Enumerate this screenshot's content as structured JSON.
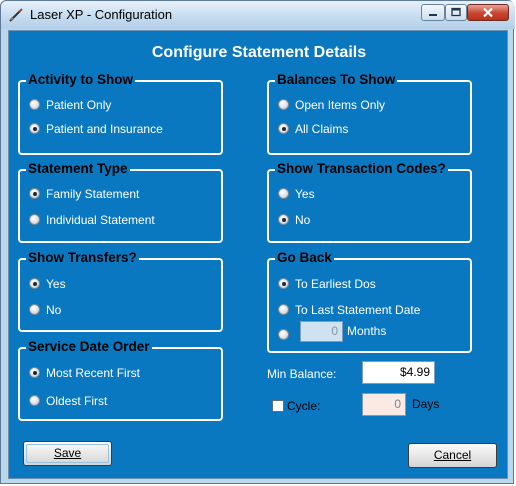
{
  "window": {
    "title": "Laser XP - Configuration",
    "controls": [
      "minimize-icon",
      "maximize-icon",
      "close-icon"
    ]
  },
  "heading": "Configure Statement Details",
  "groups": {
    "activity": {
      "title": "Activity to Show",
      "options": [
        {
          "label": "Patient Only",
          "checked": false
        },
        {
          "label": "Patient and Insurance",
          "checked": true
        }
      ]
    },
    "statement_type": {
      "title": "Statement Type",
      "options": [
        {
          "label": "Family Statement",
          "checked": true
        },
        {
          "label": "Individual Statement",
          "checked": false
        }
      ]
    },
    "transfers": {
      "title": "Show Transfers?",
      "options": [
        {
          "label": "Yes",
          "checked": true
        },
        {
          "label": "No",
          "checked": false
        }
      ]
    },
    "service_date": {
      "title": "Service Date Order",
      "options": [
        {
          "label": "Most Recent First",
          "checked": true
        },
        {
          "label": "Oldest First",
          "checked": false
        }
      ]
    },
    "balances": {
      "title": "Balances To Show",
      "options": [
        {
          "label": "Open Items Only",
          "checked": false
        },
        {
          "label": "All Claims",
          "checked": true
        }
      ]
    },
    "transaction_codes": {
      "title": "Show Transaction Codes?",
      "options": [
        {
          "label": "Yes",
          "checked": false
        },
        {
          "label": "No",
          "checked": true
        }
      ]
    },
    "go_back": {
      "title": "Go Back",
      "options": [
        {
          "label": "To Earliest Dos",
          "checked": true
        },
        {
          "label": "To Last Statement Date",
          "checked": false
        },
        {
          "label": "",
          "checked": false
        }
      ],
      "months_value": "0",
      "months_label": "Months"
    }
  },
  "min_balance": {
    "label": "Min Balance:",
    "value": "$4.99"
  },
  "cycle": {
    "label": "Cycle:",
    "checked": false,
    "value": "0",
    "unit": "Days"
  },
  "buttons": {
    "save": "Save",
    "cancel": "Cancel"
  },
  "colors": {
    "panel": "#0a78c0",
    "titlebar": "#c6dcf0",
    "close": "#c9442e"
  }
}
